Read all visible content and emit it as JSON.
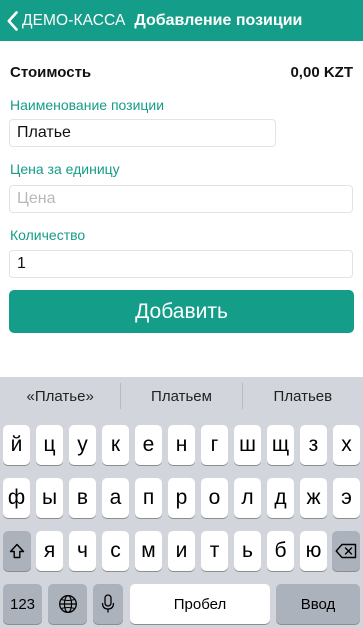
{
  "nav": {
    "back_label": "ДЕМО-КАССА",
    "title": "Добавление позиции"
  },
  "cost": {
    "label": "Стоимость",
    "value": "0,00 KZT"
  },
  "fields": {
    "name": {
      "label": "Наименование позиции",
      "value": "Платье",
      "placeholder": ""
    },
    "price": {
      "label": "Цена за единицу",
      "value": "",
      "placeholder": "Цена"
    },
    "qty": {
      "label": "Количество",
      "value": "1",
      "placeholder": ""
    }
  },
  "add_button": "Добавить",
  "keyboard": {
    "suggestions": [
      "«Платье»",
      "Платьем",
      "Платьев"
    ],
    "row1": [
      "й",
      "ц",
      "у",
      "к",
      "е",
      "н",
      "г",
      "ш",
      "щ",
      "з",
      "х"
    ],
    "row2": [
      "ф",
      "ы",
      "в",
      "а",
      "п",
      "р",
      "о",
      "л",
      "д",
      "ж",
      "э"
    ],
    "row3": [
      "я",
      "ч",
      "с",
      "м",
      "и",
      "т",
      "ь",
      "б",
      "ю"
    ],
    "numbers_label": "123",
    "space_label": "Пробел",
    "return_label": "Ввод",
    "icons": {
      "shift": "shift-icon",
      "delete": "backspace-icon",
      "globe": "globe-icon",
      "mic": "microphone-icon"
    }
  },
  "colors": {
    "accent": "#149d88",
    "keyboard_bg": "#d2d5db",
    "key_dark": "#acb2bb"
  }
}
